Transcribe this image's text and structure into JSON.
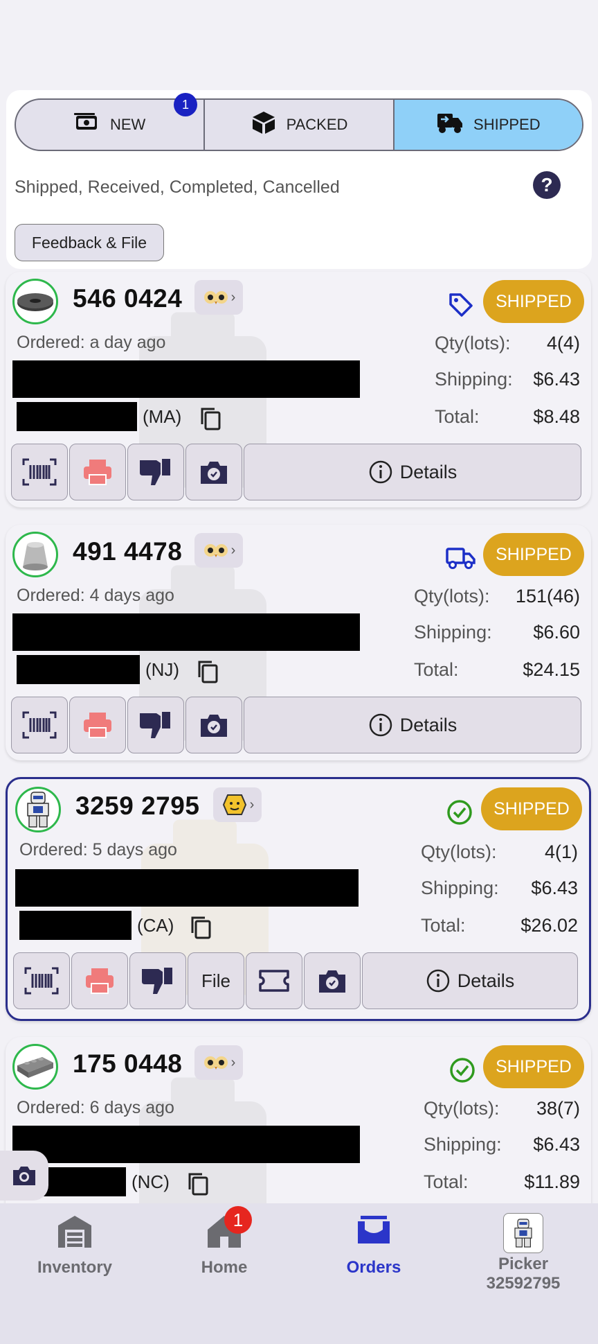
{
  "tabs": [
    {
      "label": "NEW",
      "icon": "cash-icon",
      "badge": "1",
      "active": false
    },
    {
      "label": "PACKED",
      "icon": "package-icon",
      "active": false
    },
    {
      "label": "SHIPPED",
      "icon": "truck-icon",
      "active": true
    }
  ],
  "filter_text": "Shipped, Received, Completed, Cancelled",
  "help_label": "?",
  "feedback_button": "Feedback & File",
  "labels": {
    "qty": "Qty(lots):",
    "shipping": "Shipping:",
    "total": "Total:",
    "details": "Details",
    "file": "File"
  },
  "orders": [
    {
      "number": "546 0424",
      "status": "SHIPPED",
      "status_icon": "tag-icon",
      "ordered": "Ordered: a day ago",
      "state": "(MA)",
      "qty": "4(4)",
      "shipping": "$6.43",
      "total": "$8.48",
      "source": "owl"
    },
    {
      "number": "491 4478",
      "status": "SHIPPED",
      "status_icon": "truck-icon",
      "ordered": "Ordered: 4 days ago",
      "state": "(NJ)",
      "qty": "151(46)",
      "shipping": "$6.60",
      "total": "$24.15",
      "source": "owl"
    },
    {
      "number": "3259 2795",
      "status": "SHIPPED",
      "status_icon": "check-circle-icon",
      "ordered": "Ordered: 5 days ago",
      "state": "(CA)",
      "qty": "4(1)",
      "shipping": "$6.43",
      "total": "$26.02",
      "source": "lego-head",
      "selected": true
    },
    {
      "number": "175 0448",
      "status": "SHIPPED",
      "status_icon": "check-circle-icon",
      "ordered": "Ordered: 6 days ago",
      "state": "(NC)",
      "qty": "38(7)",
      "shipping": "$6.43",
      "total": "$11.89",
      "source": "owl"
    }
  ],
  "nav": [
    {
      "label": "Inventory",
      "icon": "warehouse-icon",
      "active": false
    },
    {
      "label": "Home",
      "icon": "home-icon",
      "badge": "1",
      "active": false
    },
    {
      "label": "Orders",
      "icon": "inbox-icon",
      "active": true
    },
    {
      "label": "Picker",
      "sublabel": "32592795",
      "icon": "minifig-avatar",
      "active": false
    }
  ],
  "colors": {
    "shipped_pill": "#dca41e",
    "active_tab": "#8fd0f8",
    "nav_active": "#2b35c9",
    "badge_blue": "#1a22c2",
    "badge_red": "#e6261f",
    "thumb_ring": "#2eb84c",
    "selected_border": "#2a2e8c"
  }
}
